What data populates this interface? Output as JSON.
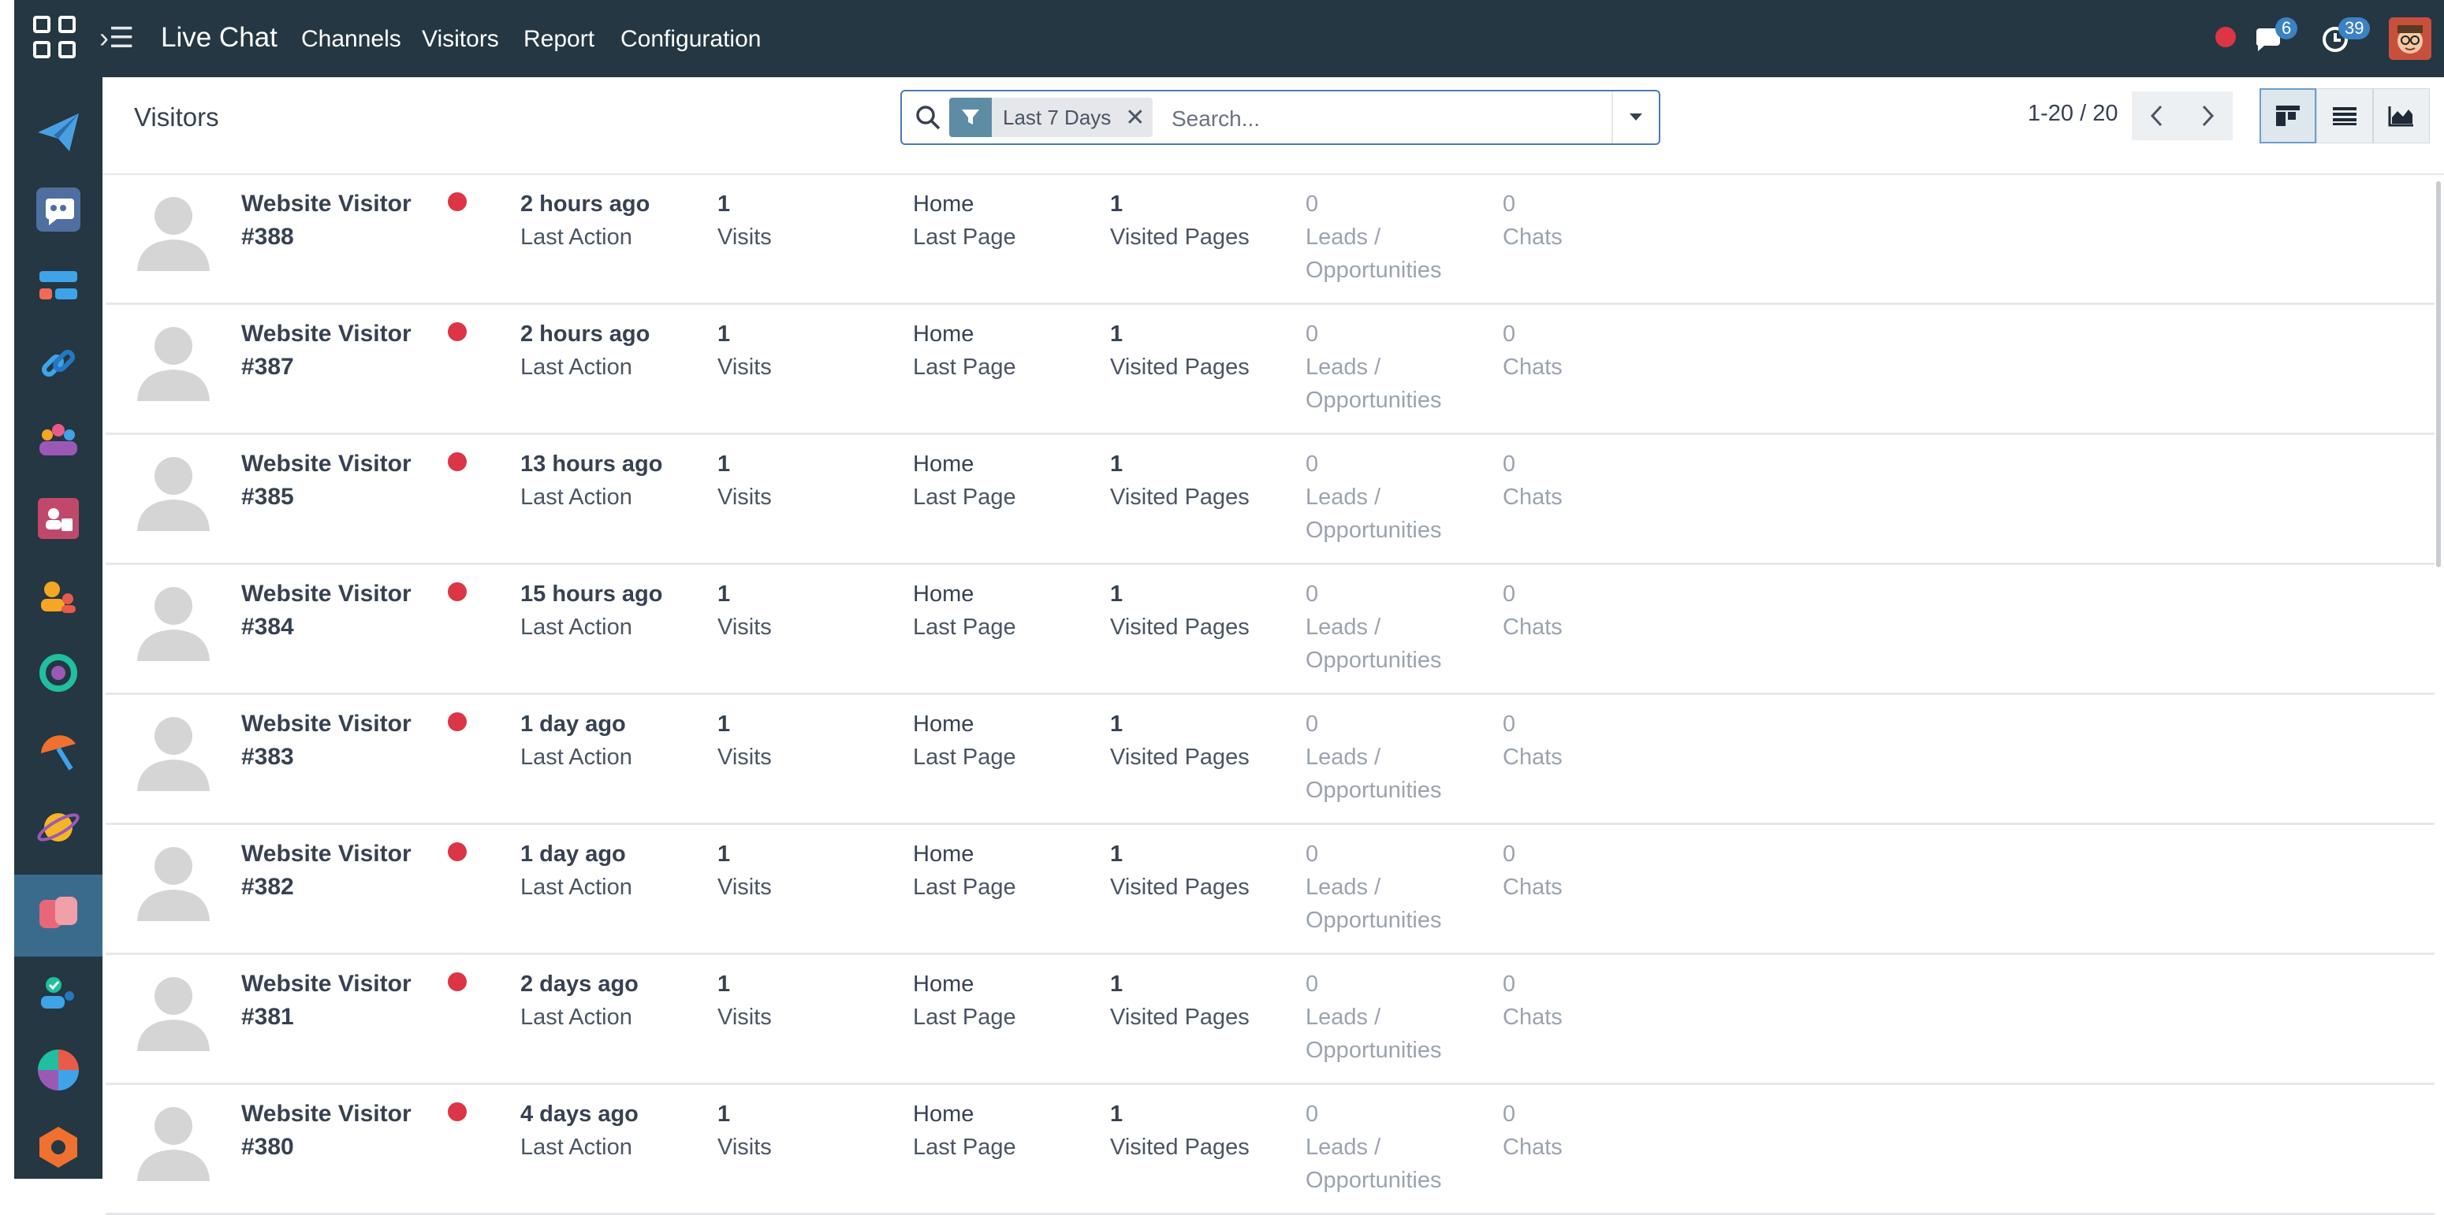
{
  "topbar": {
    "app_title": "Live Chat",
    "nav": [
      "Channels",
      "Visitors",
      "Report",
      "Configuration"
    ],
    "messages_badge": "6",
    "activities_badge": "39",
    "colors": {
      "navbar": "#243742",
      "status_red": "#dc3545",
      "badge": "#3b82c4"
    }
  },
  "sidebar": {
    "apps": [
      "email-marketing-icon",
      "chatbot-icon",
      "events-icon",
      "link-tracker-icon",
      "employees-icon",
      "payroll-icon",
      "appraisals-icon",
      "quality-icon",
      "field-service-icon",
      "planning-icon",
      "live-chat-icon",
      "approvals-icon",
      "dashboards-icon",
      "iot-icon"
    ]
  },
  "control": {
    "breadcrumb": "Visitors",
    "filter_facet": "Last 7 Days",
    "search_placeholder": "Search...",
    "pager": "1-20 / 20",
    "views": [
      "kanban-view-icon",
      "list-view-icon",
      "graph-view-icon"
    ]
  },
  "labels": {
    "last_action": "Last Action",
    "visits": "Visits",
    "last_page": "Last Page",
    "visited_pages": "Visited Pages",
    "leads_1": "Leads /",
    "leads_2": "Opportunities",
    "chats": "Chats"
  },
  "visitors": [
    {
      "name_1": "Website Visitor",
      "name_2": "#388",
      "last_action": "2 hours ago",
      "visits": "1",
      "last_page": "Home",
      "visited_pages": "1",
      "leads": "0",
      "chats": "0"
    },
    {
      "name_1": "Website Visitor",
      "name_2": "#387",
      "last_action": "2 hours ago",
      "visits": "1",
      "last_page": "Home",
      "visited_pages": "1",
      "leads": "0",
      "chats": "0"
    },
    {
      "name_1": "Website Visitor",
      "name_2": "#385",
      "last_action": "13 hours ago",
      "visits": "1",
      "last_page": "Home",
      "visited_pages": "1",
      "leads": "0",
      "chats": "0"
    },
    {
      "name_1": "Website Visitor",
      "name_2": "#384",
      "last_action": "15 hours ago",
      "visits": "1",
      "last_page": "Home",
      "visited_pages": "1",
      "leads": "0",
      "chats": "0"
    },
    {
      "name_1": "Website Visitor",
      "name_2": "#383",
      "last_action": "1 day ago",
      "visits": "1",
      "last_page": "Home",
      "visited_pages": "1",
      "leads": "0",
      "chats": "0"
    },
    {
      "name_1": "Website Visitor",
      "name_2": "#382",
      "last_action": "1 day ago",
      "visits": "1",
      "last_page": "Home",
      "visited_pages": "1",
      "leads": "0",
      "chats": "0"
    },
    {
      "name_1": "Website Visitor",
      "name_2": "#381",
      "last_action": "2 days ago",
      "visits": "1",
      "last_page": "Home",
      "visited_pages": "1",
      "leads": "0",
      "chats": "0"
    },
    {
      "name_1": "Website Visitor",
      "name_2": "#380",
      "last_action": "4 days ago",
      "visits": "1",
      "last_page": "Home",
      "visited_pages": "1",
      "leads": "0",
      "chats": "0"
    }
  ]
}
